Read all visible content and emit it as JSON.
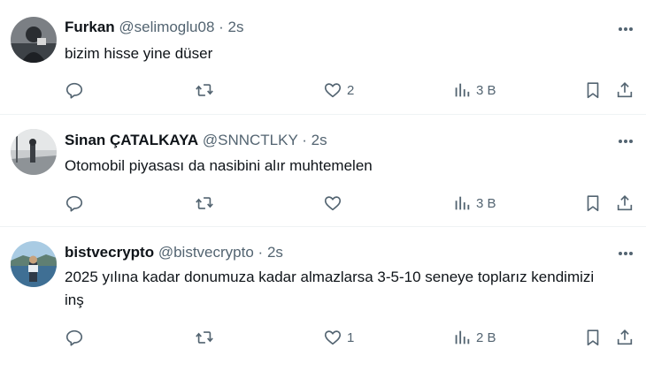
{
  "tweets": [
    {
      "name": "Furkan",
      "handle": "@selimoglu08",
      "dot": "·",
      "time": "2s",
      "text": "bizim hisse yine düser",
      "likes": "2",
      "views": "3 B"
    },
    {
      "name": "Sinan ÇATALKAYA",
      "handle": "@SNNCTLKY",
      "dot": "·",
      "time": "2s",
      "text": "Otomobil piyasası da nasibini alır muhtemelen",
      "likes": "",
      "views": "3 B"
    },
    {
      "name": "bistvecrypto",
      "handle": "@bistvecrypto",
      "dot": "·",
      "time": "2s",
      "text": "2025 yılına kadar donumuza kadar almazlarsa 3-5-10 seneye toplarız kendimizi inş",
      "likes": "1",
      "views": "2 B"
    }
  ],
  "icons": {
    "reply": "reply-icon",
    "retweet": "retweet-icon",
    "like": "heart-icon",
    "views": "views-icon",
    "bookmark": "bookmark-icon",
    "share": "share-icon",
    "more": "more-icon"
  },
  "colors": {
    "text": "#0f1419",
    "secondary": "#536471",
    "divider": "#eff3f4"
  }
}
